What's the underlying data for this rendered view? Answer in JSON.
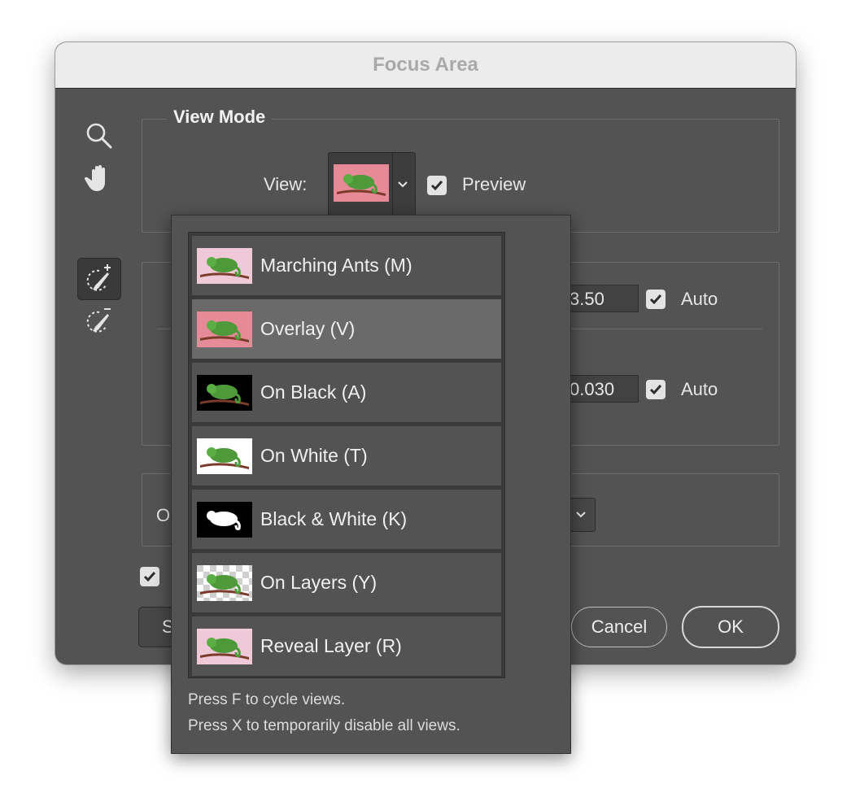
{
  "window": {
    "title": "Focus Area"
  },
  "tools": {
    "zoom": "zoom-icon",
    "hand": "hand-icon",
    "add_brush": "focus-area-add-tool-icon",
    "subtract_brush": "focus-area-subtract-tool-icon"
  },
  "view_mode": {
    "legend": "View Mode",
    "view_label": "View:",
    "preview_label": "Preview",
    "preview_checked": true
  },
  "parameters": {
    "field1_value": "3.50",
    "field1_auto_label": "Auto",
    "field2_value": "0.030",
    "field2_auto_label": "Auto"
  },
  "output": {
    "label_partial": "O"
  },
  "buttons": {
    "save_partial": "S",
    "cancel": "Cancel",
    "ok": "OK"
  },
  "dropdown": {
    "items": [
      {
        "label": "Marching Ants (M)",
        "thumb": "pink-light"
      },
      {
        "label": "Overlay (V)",
        "thumb": "pink"
      },
      {
        "label": "On Black (A)",
        "thumb": "black"
      },
      {
        "label": "On White (T)",
        "thumb": "white"
      },
      {
        "label": "Black & White (K)",
        "thumb": "bw"
      },
      {
        "label": "On Layers (Y)",
        "thumb": "checker"
      },
      {
        "label": "Reveal Layer (R)",
        "thumb": "pink-light"
      }
    ],
    "selected_index": 1,
    "hint1": "Press F to cycle views.",
    "hint2": "Press X to temporarily disable all views."
  },
  "colors": {
    "dialog_bg": "#535353",
    "titlebar_bg": "#ececec",
    "highlight_row": "#6a6a6a",
    "chameleon_green": "#4e9a3a"
  }
}
